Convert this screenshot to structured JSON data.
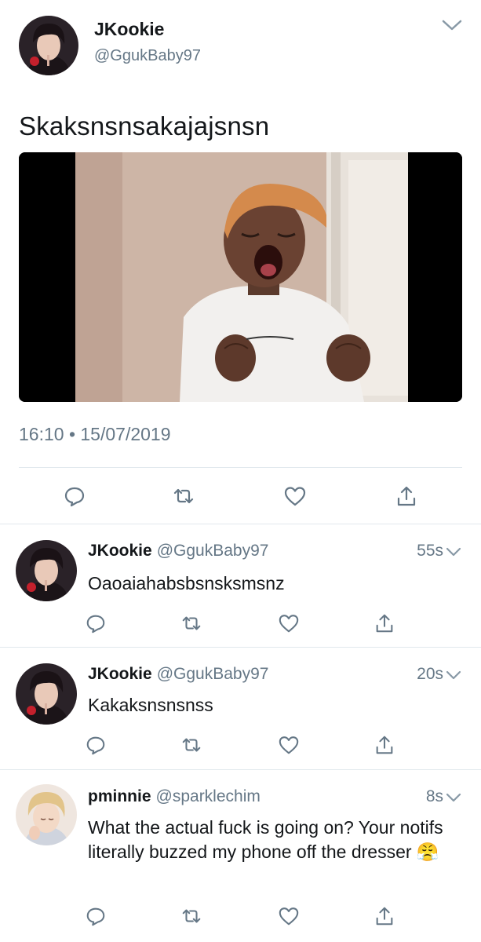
{
  "main_tweet": {
    "display_name": "JKookie",
    "handle": "@GgukBaby97",
    "text": "Skaksnsnsakajajsnsn",
    "timestamp": "16:10 • 15/07/2019",
    "media_description": "crying-woman-reaction-image",
    "actions": [
      "reply-icon",
      "retweet-icon",
      "like-icon",
      "share-icon"
    ]
  },
  "replies": [
    {
      "display_name": "JKookie",
      "handle": "@GgukBaby97",
      "time": "55s",
      "text": "Oaoaiahabsbsnsksmsnz"
    },
    {
      "display_name": "JKookie",
      "handle": "@GgukBaby97",
      "time": "20s",
      "text": "Kakaksnsnsnss"
    },
    {
      "display_name": "pminnie",
      "handle": "@sparklechim",
      "time": "8s",
      "text": "What the actual fuck is going on? Your notifs literally buzzed my phone off the dresser",
      "emoji": "😤"
    }
  ],
  "colors": {
    "text_primary": "#14171a",
    "text_secondary": "#657786",
    "divider": "#e1e8ed",
    "icon": "#657786"
  }
}
